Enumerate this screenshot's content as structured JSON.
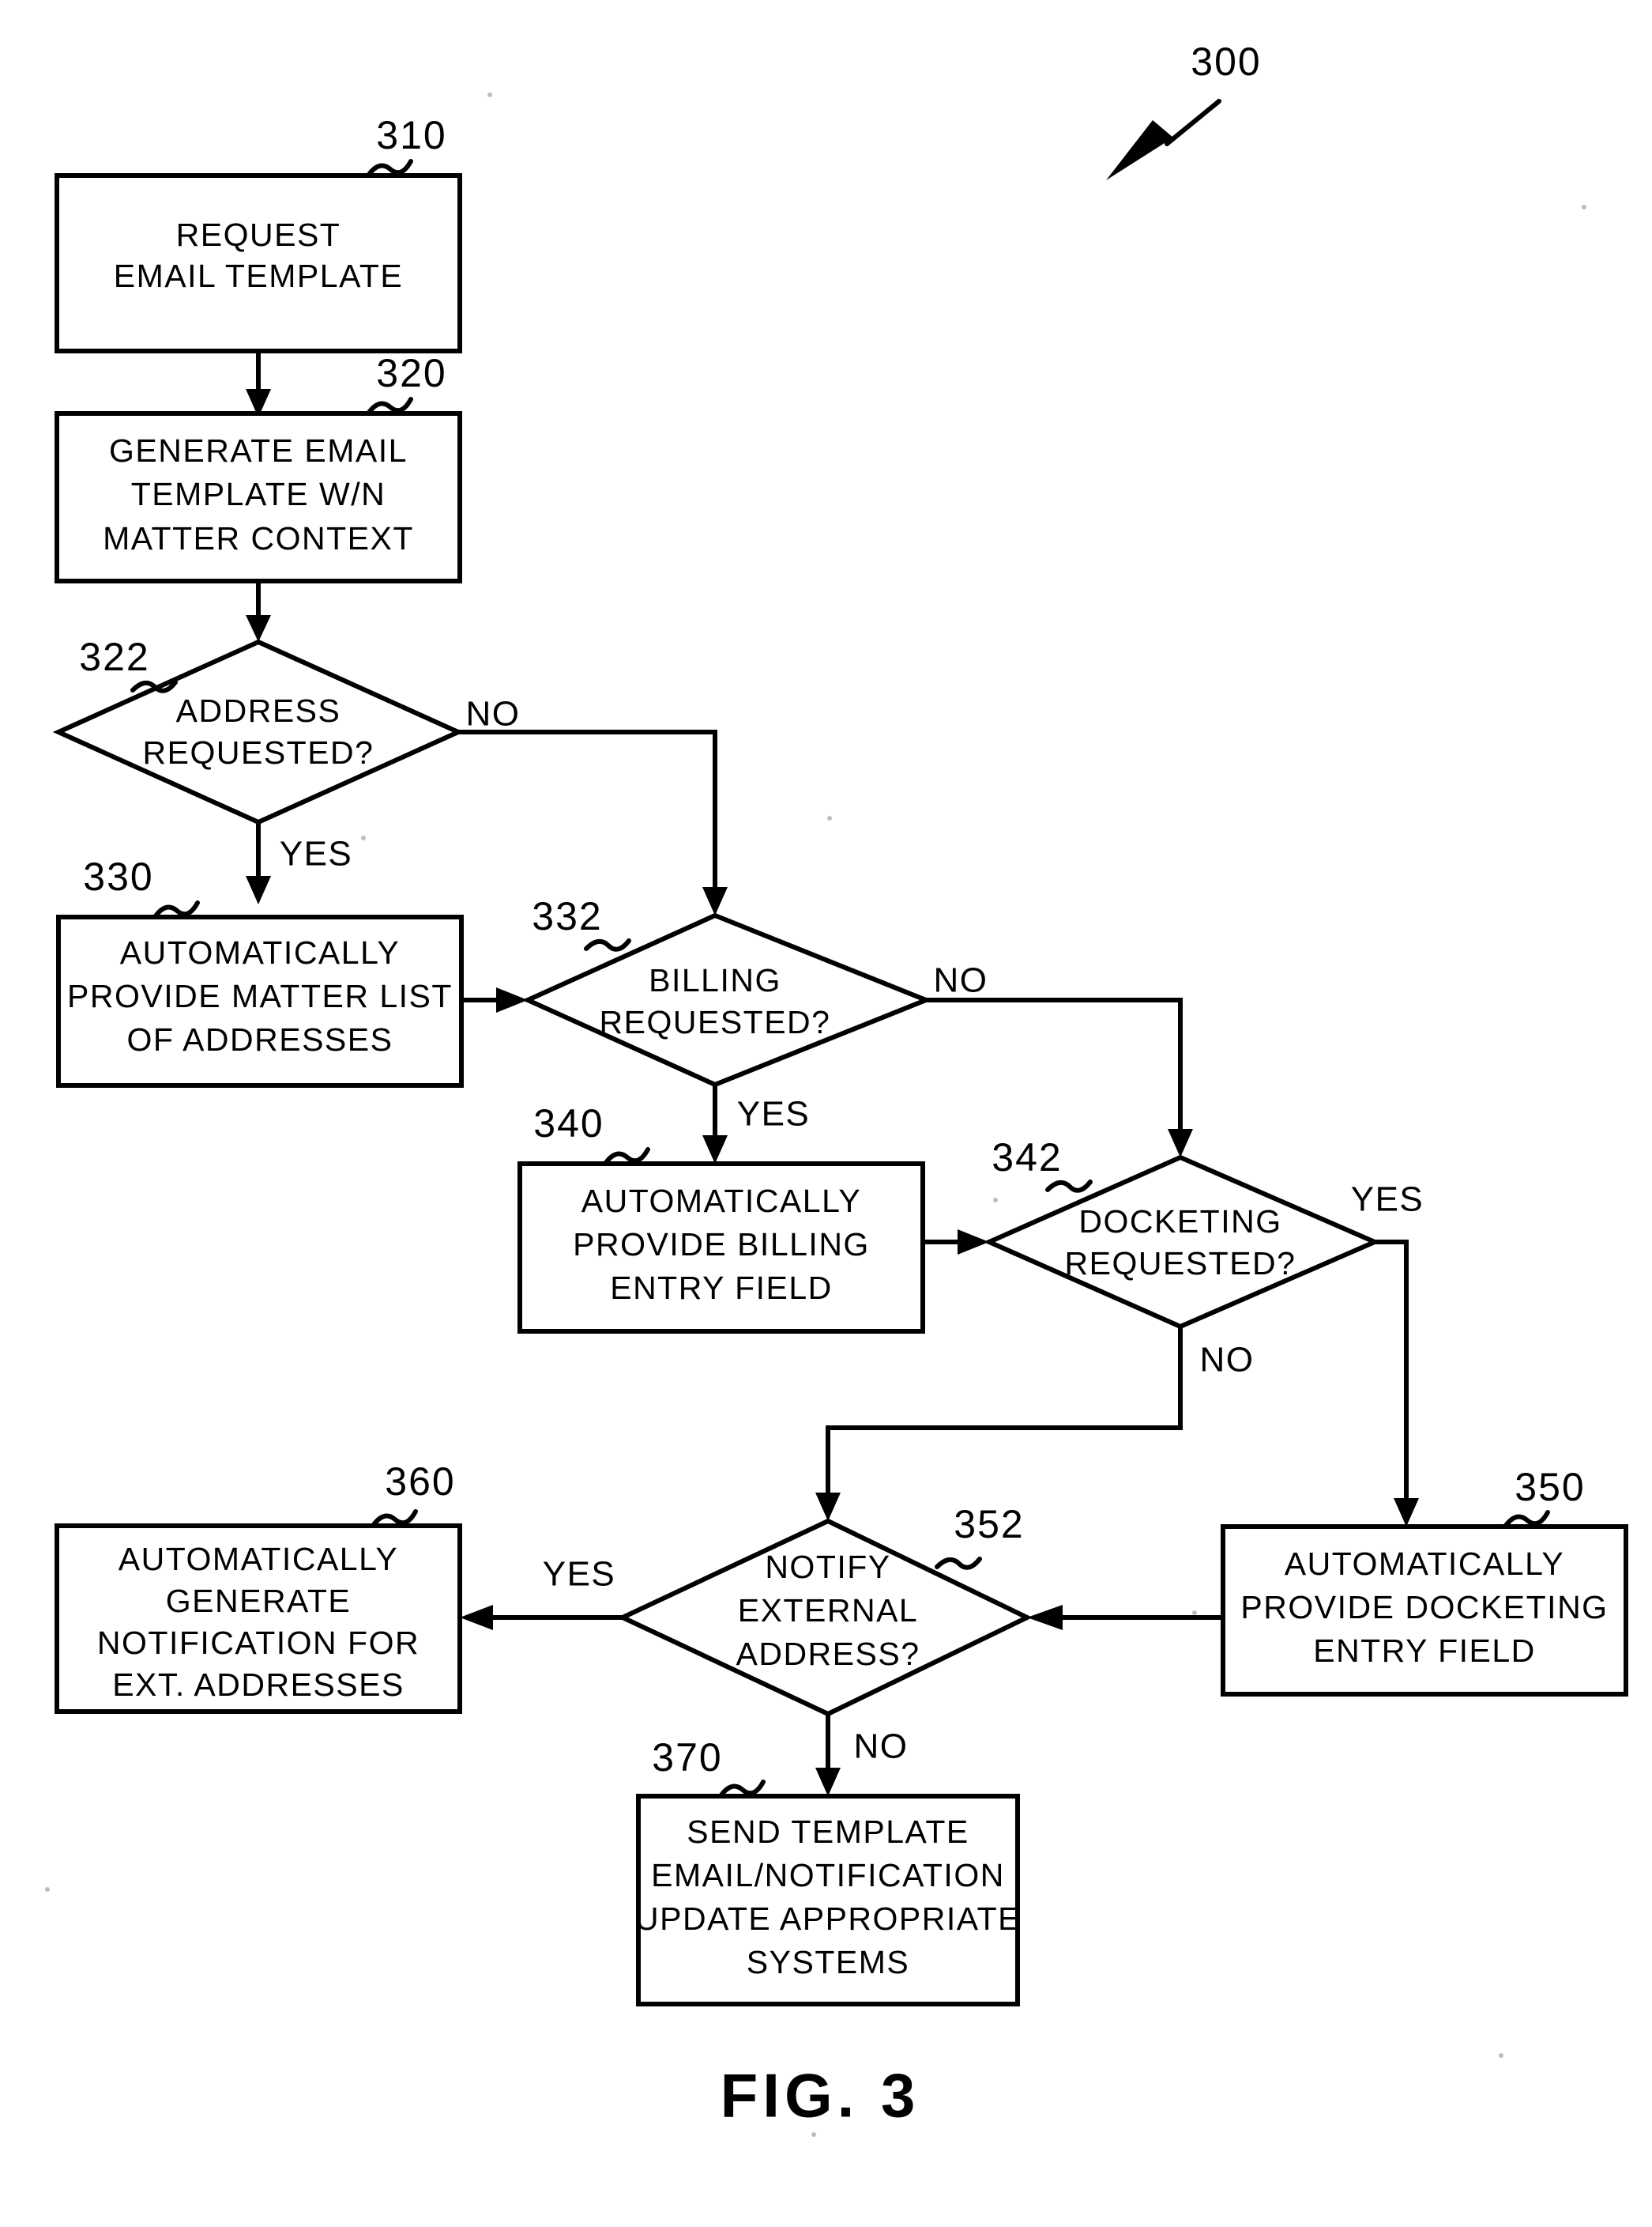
{
  "figure": {
    "caption": "FIG.  3",
    "diagram_ref": "300",
    "type": "flowchart"
  },
  "nodes": [
    {
      "id": "310",
      "ref": "310",
      "shape": "process",
      "lines": [
        "REQUEST",
        "EMAIL TEMPLATE"
      ]
    },
    {
      "id": "320",
      "ref": "320",
      "shape": "process",
      "lines": [
        "GENERATE EMAIL",
        "TEMPLATE W/N",
        "MATTER CONTEXT"
      ]
    },
    {
      "id": "322",
      "ref": "322",
      "shape": "decision",
      "lines": [
        "ADDRESS",
        "REQUESTED?"
      ]
    },
    {
      "id": "330",
      "ref": "330",
      "shape": "process",
      "lines": [
        "AUTOMATICALLY",
        "PROVIDE MATTER LIST",
        "OF ADDRESSES"
      ]
    },
    {
      "id": "332",
      "ref": "332",
      "shape": "decision",
      "lines": [
        "BILLING",
        "REQUESTED?"
      ]
    },
    {
      "id": "340",
      "ref": "340",
      "shape": "process",
      "lines": [
        "AUTOMATICALLY",
        "PROVIDE BILLING",
        "ENTRY FIELD"
      ]
    },
    {
      "id": "342",
      "ref": "342",
      "shape": "decision",
      "lines": [
        "DOCKETING",
        "REQUESTED?"
      ]
    },
    {
      "id": "350",
      "ref": "350",
      "shape": "process",
      "lines": [
        "AUTOMATICALLY",
        "PROVIDE DOCKETING",
        "ENTRY FIELD"
      ]
    },
    {
      "id": "352",
      "ref": "352",
      "shape": "decision",
      "lines": [
        "NOTIFY",
        "EXTERNAL",
        "ADDRESS?"
      ]
    },
    {
      "id": "360",
      "ref": "360",
      "shape": "process",
      "lines": [
        "AUTOMATICALLY",
        "GENERATE",
        "NOTIFICATION FOR",
        "EXT. ADDRESSES"
      ]
    },
    {
      "id": "370",
      "ref": "370",
      "shape": "process",
      "lines": [
        "SEND TEMPLATE",
        "EMAIL/NOTIFICATION",
        "UPDATE APPROPRIATE",
        "SYSTEMS"
      ]
    }
  ],
  "edges": [
    {
      "from": "310",
      "to": "320",
      "label": ""
    },
    {
      "from": "320",
      "to": "322",
      "label": ""
    },
    {
      "from": "322",
      "to": "330",
      "label": "YES"
    },
    {
      "from": "322",
      "to": "332",
      "label": "NO"
    },
    {
      "from": "330",
      "to": "332",
      "label": ""
    },
    {
      "from": "332",
      "to": "340",
      "label": "YES"
    },
    {
      "from": "332",
      "to": "342",
      "label": "NO"
    },
    {
      "from": "340",
      "to": "342",
      "label": ""
    },
    {
      "from": "342",
      "to": "350",
      "label": "YES"
    },
    {
      "from": "342",
      "to": "352",
      "label": "NO"
    },
    {
      "from": "350",
      "to": "352",
      "label": ""
    },
    {
      "from": "352",
      "to": "360",
      "label": "YES"
    },
    {
      "from": "352",
      "to": "370",
      "label": "NO"
    }
  ],
  "text": {
    "n310_l0": "REQUEST",
    "n310_l1": "EMAIL TEMPLATE",
    "n320_l0": "GENERATE EMAIL",
    "n320_l1": "TEMPLATE W/N",
    "n320_l2": "MATTER CONTEXT",
    "n322_l0": "ADDRESS",
    "n322_l1": "REQUESTED?",
    "n330_l0": "AUTOMATICALLY",
    "n330_l1": "PROVIDE MATTER LIST",
    "n330_l2": "OF ADDRESSES",
    "n332_l0": "BILLING",
    "n332_l1": "REQUESTED?",
    "n340_l0": "AUTOMATICALLY",
    "n340_l1": "PROVIDE BILLING",
    "n340_l2": "ENTRY FIELD",
    "n342_l0": "DOCKETING",
    "n342_l1": "REQUESTED?",
    "n350_l0": "AUTOMATICALLY",
    "n350_l1": "PROVIDE DOCKETING",
    "n350_l2": "ENTRY FIELD",
    "n352_l0": "NOTIFY",
    "n352_l1": "EXTERNAL",
    "n352_l2": "ADDRESS?",
    "n360_l0": "AUTOMATICALLY",
    "n360_l1": "GENERATE",
    "n360_l2": "NOTIFICATION FOR",
    "n360_l3": "EXT. ADDRESSES",
    "n370_l0": "SEND TEMPLATE",
    "n370_l1": "EMAIL/NOTIFICATION",
    "n370_l2": "UPDATE APPROPRIATE",
    "n370_l3": "SYSTEMS",
    "ref_300": "300",
    "ref_310": "310",
    "ref_320": "320",
    "ref_322": "322",
    "ref_330": "330",
    "ref_332": "332",
    "ref_340": "340",
    "ref_342": "342",
    "ref_350": "350",
    "ref_352": "352",
    "ref_360": "360",
    "ref_370": "370",
    "lbl_322_no": "NO",
    "lbl_322_yes": "YES",
    "lbl_332_no": "NO",
    "lbl_332_yes": "YES",
    "lbl_342_no": "NO",
    "lbl_342_yes": "YES",
    "lbl_352_no": "NO",
    "lbl_352_yes": "YES",
    "caption": "FIG.  3"
  },
  "colors": {
    "ink": "#000000",
    "paper": "#ffffff"
  }
}
